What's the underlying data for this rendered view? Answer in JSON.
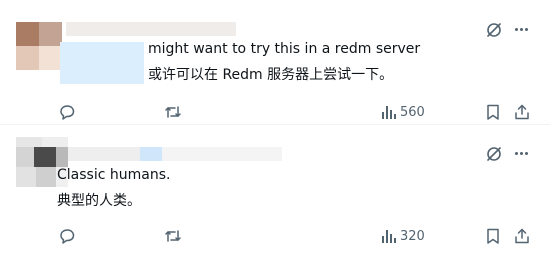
{
  "tweets": [
    {
      "text": "might want to try this in a redm server",
      "translation": "或许可以在 Redm 服务器上尝试一下。",
      "views": "560"
    },
    {
      "text": "Classic humans.",
      "translation": "典型的人类。",
      "views": "320"
    }
  ],
  "icons": {
    "grok": "grok-icon",
    "more": "more-icon",
    "reply": "reply-icon",
    "retweet": "retweet-icon",
    "views": "views-icon",
    "bookmark": "bookmark-icon",
    "share": "share-icon"
  },
  "colors": {
    "text": "#0f1419",
    "secondary": "#536471",
    "divider": "#eff3f4"
  }
}
